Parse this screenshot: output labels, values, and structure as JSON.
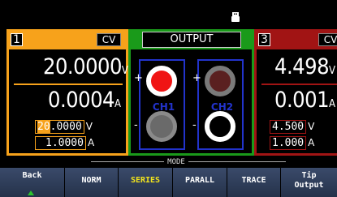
{
  "status": {
    "usb_icon": "usb-icon"
  },
  "ch1": {
    "num": "1",
    "mode": "CV",
    "voltage": "20.0000",
    "voltage_unit": "V",
    "current": "0.0004",
    "current_unit": "A",
    "set_voltage_hl": "20",
    "set_voltage_rest": ".0000",
    "set_voltage_unit": "V",
    "set_current": "1.0000",
    "set_current_unit": "A",
    "color": "#f7a21b"
  },
  "output": {
    "title": "OUTPUT",
    "ch1_label": "CH1",
    "ch2_label": "CH2",
    "plus": "+",
    "minus": "-",
    "color": "#1a9a1a"
  },
  "ch3": {
    "num": "3",
    "mode": "CV",
    "voltage": "4.498",
    "voltage_unit": "V",
    "current": "0.001",
    "current_unit": "A",
    "set_voltage": "4.500",
    "set_voltage_unit": "V",
    "set_current": "1.000",
    "set_current_unit": "A",
    "color": "#a11414"
  },
  "softkeys": {
    "mode_label": "MODE",
    "back": "Back",
    "norm": "NORM",
    "series": "SERIES",
    "parall": "PARALL",
    "trace": "TRACE",
    "tip_line1": "Tip",
    "tip_line2": "Output"
  }
}
